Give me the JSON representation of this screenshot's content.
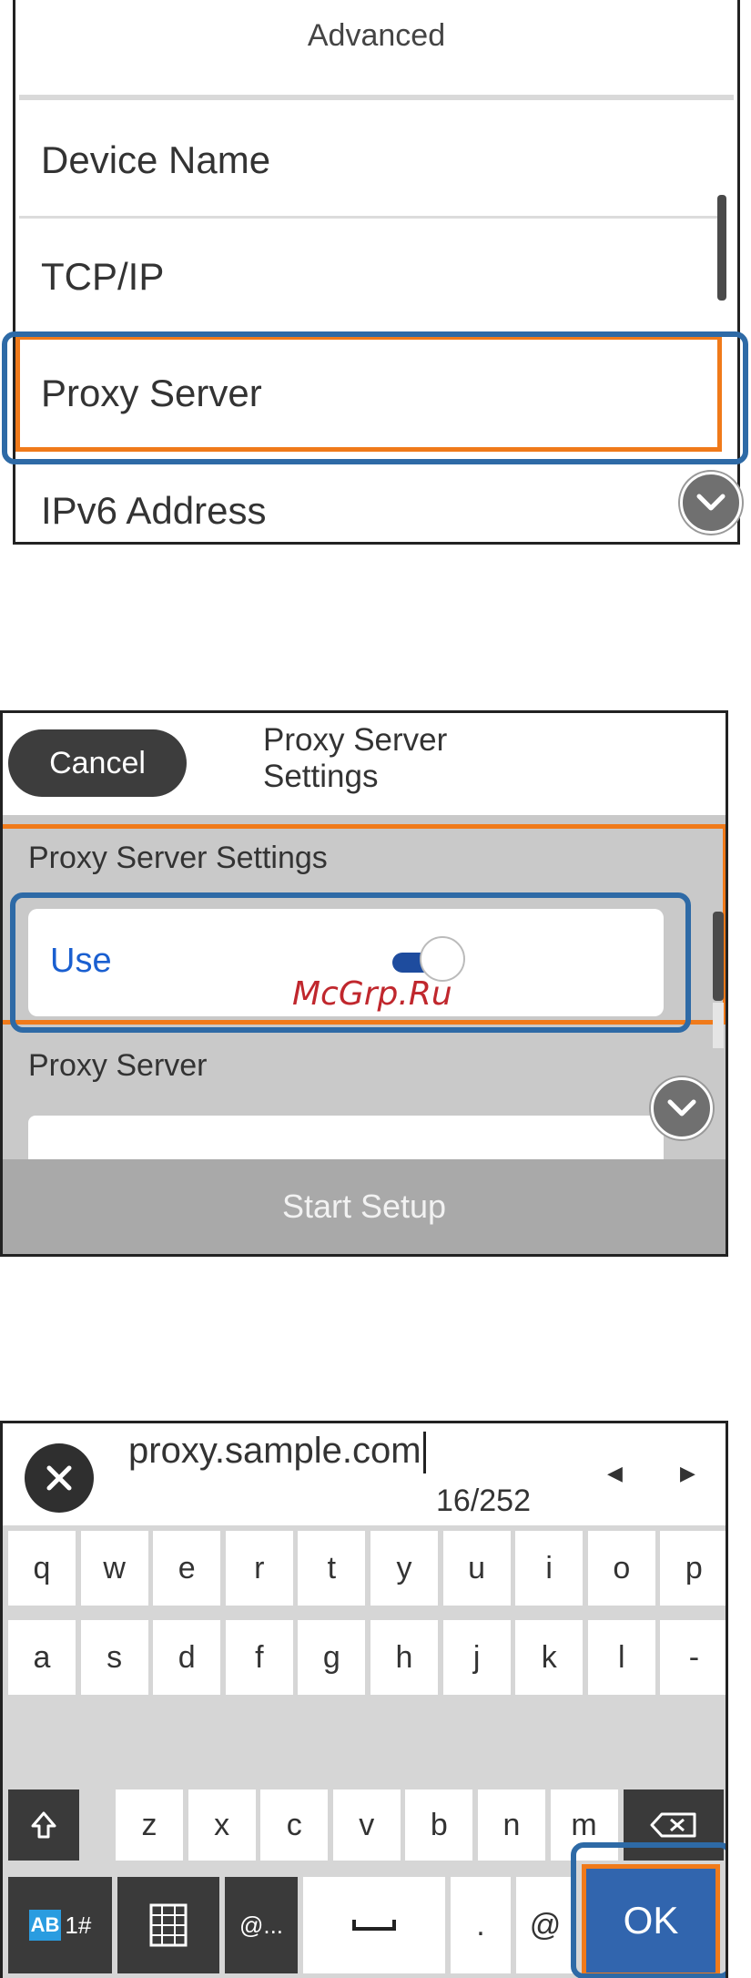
{
  "screen1": {
    "title": "Advanced",
    "items": [
      {
        "label": "Device Name"
      },
      {
        "label": "TCP/IP"
      },
      {
        "label": "Proxy Server",
        "selected": true
      },
      {
        "label": "IPv6 Address"
      }
    ],
    "scroll_down_icon": "chevron-down-icon"
  },
  "screen2": {
    "cancel_label": "Cancel",
    "title_line1": "Proxy Server",
    "title_line2": "Settings",
    "section_label": "Proxy Server Settings",
    "use_label": "Use",
    "use_enabled": true,
    "proxy_server_label": "Proxy Server",
    "start_setup_label": "Start Setup",
    "watermark": "McGrp.Ru"
  },
  "screen3": {
    "input_value": "proxy.sample.com",
    "char_count": "16/252",
    "arrow_left": "◀",
    "arrow_right": "▶",
    "row1": [
      "q",
      "w",
      "e",
      "r",
      "t",
      "y",
      "u",
      "i",
      "o",
      "p"
    ],
    "row2": [
      "a",
      "s",
      "d",
      "f",
      "g",
      "h",
      "j",
      "k",
      "l",
      "-"
    ],
    "row3": [
      "z",
      "x",
      "c",
      "v",
      "b",
      "n",
      "m"
    ],
    "mode_ab": "AB",
    "mode_num": "1#",
    "at_dots": "@...",
    "dot": ".",
    "at": "@",
    "ok_label": "OK"
  },
  "colors": {
    "highlight_blue": "#2e6aa6",
    "focus_orange": "#f07a1a",
    "ok_blue": "#3165ae",
    "use_blue": "#1a5fd0"
  }
}
